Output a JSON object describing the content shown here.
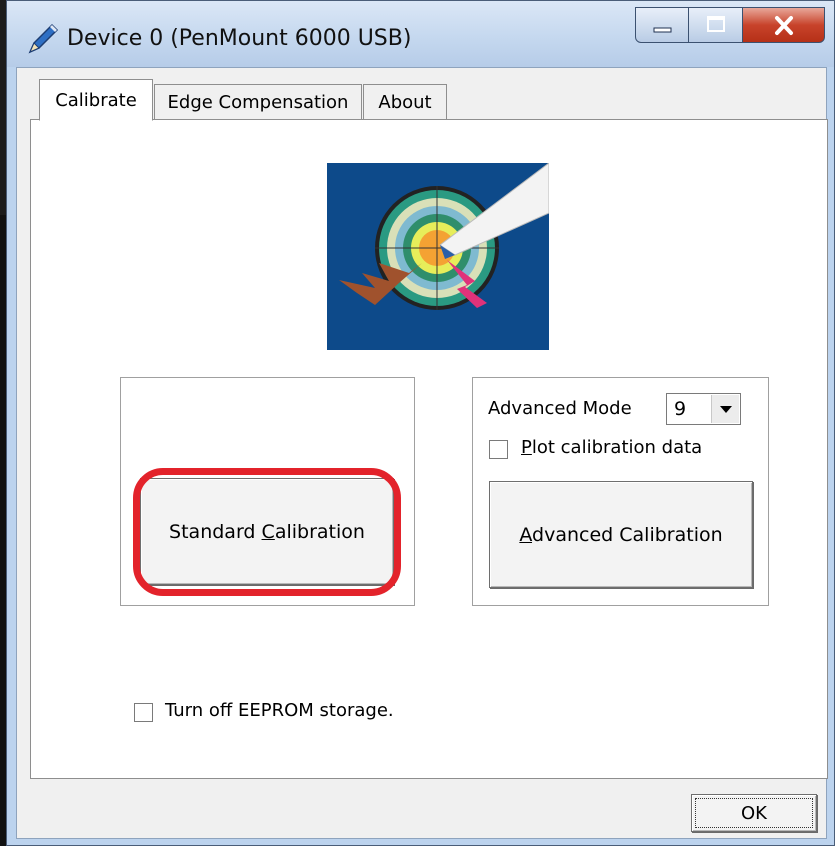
{
  "window": {
    "title": "Device 0 (PenMount 6000 USB)"
  },
  "tabs": [
    {
      "label": "Calibrate",
      "active": true
    },
    {
      "label": "Edge Compensation",
      "active": false
    },
    {
      "label": "About",
      "active": false
    }
  ],
  "calibrate": {
    "standard_button": {
      "pre": "Standard ",
      "mnemonic": "C",
      "post": "alibration"
    },
    "advanced_mode": {
      "label": "Advanced Mode",
      "value": "9"
    },
    "plot_checkbox": {
      "mnemonic": "P",
      "post": "lot calibration data",
      "checked": false
    },
    "advanced_button": {
      "mnemonic": "A",
      "post": "dvanced Calibration"
    },
    "eeprom_checkbox": {
      "label": "Turn off EEPROM storage.",
      "checked": false
    }
  },
  "footer": {
    "ok_label": "OK"
  },
  "colors": {
    "highlight": "#e3232b",
    "image_background": "#0d4a8a",
    "titlebar": "#c5d8ef"
  }
}
